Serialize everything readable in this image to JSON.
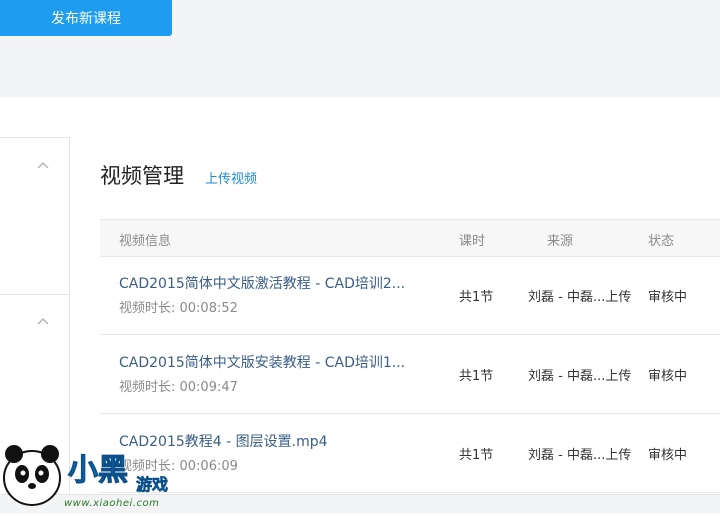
{
  "header": {
    "publish_button": "发布新课程"
  },
  "section": {
    "title": "视频管理",
    "upload_link": "上传视频"
  },
  "table": {
    "columns": [
      "视频信息",
      "课时",
      "来源",
      "状态"
    ],
    "rows": [
      {
        "title": "CAD2015简体中文版激活教程 - CAD培训2...",
        "duration": "视频时长: 00:08:52",
        "lessons": "共1节",
        "source": "刘磊 - 中磊...上传",
        "status": "审核中"
      },
      {
        "title": "CAD2015简体中文版安装教程 - CAD培训1...",
        "duration": "视频时长: 00:09:47",
        "lessons": "共1节",
        "source": "刘磊 - 中磊...上传",
        "status": "审核中"
      },
      {
        "title": "CAD2015教程4 - 图层设置.mp4",
        "duration": "视频时长: 00:06:09",
        "lessons": "共1节",
        "source": "刘磊 - 中磊...上传",
        "status": "审核中"
      }
    ]
  },
  "watermark": {
    "logo_text": "小黑游戏",
    "url": "www.xiaohei.com"
  },
  "colors": {
    "accent": "#1e9cef",
    "link": "#1f8bd6",
    "title_link": "#3a5d86"
  }
}
